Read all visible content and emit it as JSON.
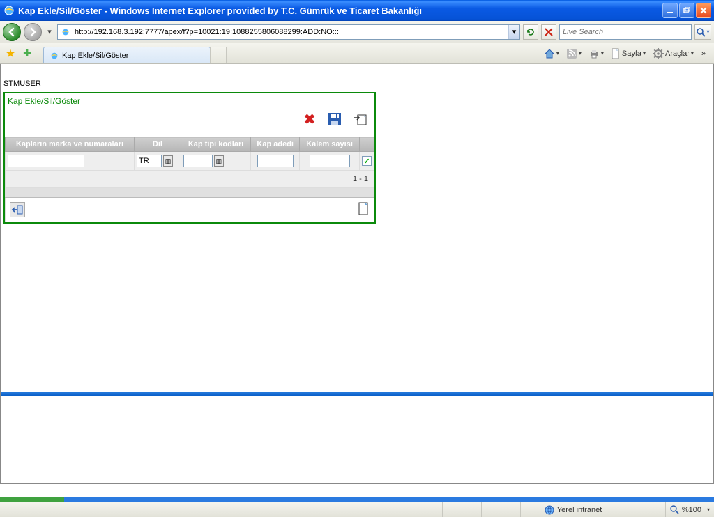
{
  "titlebar": {
    "title": "Kap Ekle/Sil/Göster - Windows Internet Explorer provided by T.C. Gümrük ve Ticaret Bakanlığı"
  },
  "nav": {
    "url": "http://192.168.3.192:7777/apex/f?p=10021:19:1088255806088299:ADD:NO:::",
    "search_placeholder": "Live Search"
  },
  "tabs": {
    "active_label": "Kap Ekle/Sil/Göster"
  },
  "commandbar": {
    "page_label": "Sayfa",
    "tools_label": "Araçlar"
  },
  "page": {
    "user": "STMUSER",
    "panel_title": "Kap Ekle/Sil/Göster",
    "columns": {
      "c1": "Kapların marka ve numaraları",
      "c2": "Dil",
      "c3": "Kap tipi kodları",
      "c4": "Kap adedi",
      "c5": "Kalem sayısı"
    },
    "row": {
      "marka": "",
      "dil": "TR",
      "kap_tipi": "",
      "kap_adedi": "",
      "kalem_sayisi": "",
      "checked": true
    },
    "pager": "1 - 1"
  },
  "status": {
    "zone": "Yerel intranet",
    "zoom": "%100"
  }
}
